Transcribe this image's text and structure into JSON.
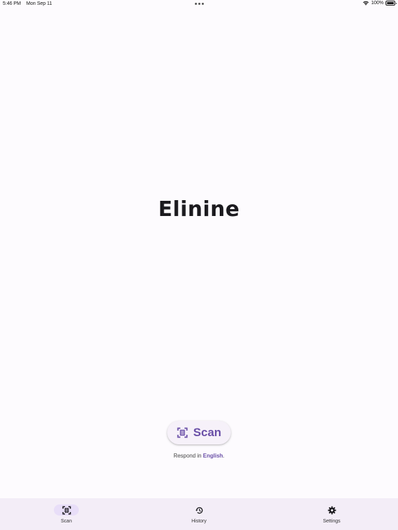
{
  "status_bar": {
    "time": "5:46 PM",
    "date": "Mon Sep 11",
    "battery": "100%"
  },
  "app": {
    "title": "Elinine"
  },
  "scan_button": {
    "label": "Scan",
    "icon": "document-scanner-icon"
  },
  "respond": {
    "prefix": "Respond in ",
    "language": "English",
    "suffix": "."
  },
  "nav": {
    "items": [
      {
        "label": "Scan",
        "icon": "document-scanner-icon",
        "active": true
      },
      {
        "label": "History",
        "icon": "history-icon",
        "active": false
      },
      {
        "label": "Settings",
        "icon": "gear-icon",
        "active": false
      }
    ]
  },
  "colors": {
    "accent": "#6a4fa7",
    "nav_background": "#f3edf7",
    "active_indicator": "#e8def8",
    "background": "#fdfbfe"
  }
}
